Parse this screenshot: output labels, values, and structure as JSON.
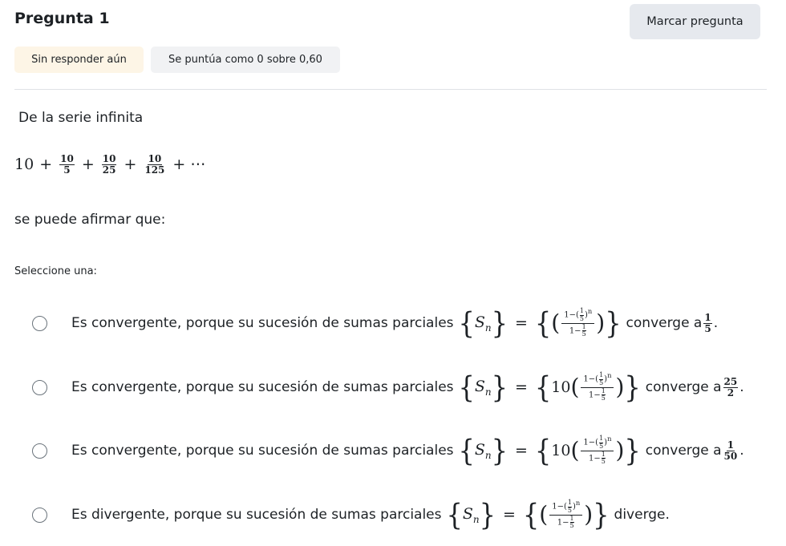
{
  "question": {
    "title": "Pregunta 1",
    "flag_label": "Marcar pregunta",
    "state": "Sin responder aún",
    "grade": "Se puntúa como 0 sobre 0,60"
  },
  "prompt": {
    "intro": "De la serie infinita",
    "series": {
      "first": "10",
      "terms": [
        {
          "num": "10",
          "den": "5"
        },
        {
          "num": "10",
          "den": "25"
        },
        {
          "num": "10",
          "den": "125"
        }
      ],
      "plus": "+",
      "ellipsis": "+ ⋯"
    },
    "outro": "se puede afirmar que:"
  },
  "select_label": "Seleccione una:",
  "formula_parts": {
    "sn_symbol": "S",
    "sn_sub": "n",
    "equals": "=",
    "numerator": "1−(",
    "numerator_exp": "n",
    "denominator": "1−",
    "one": "1",
    "five": "5"
  },
  "options": [
    {
      "prefix": "Es convergente, porque su sucesión de sumas parciales",
      "coef": "",
      "suffix": "converge a",
      "limit_num": "1",
      "limit_den": "5",
      "end": "."
    },
    {
      "prefix": "Es convergente, porque su sucesión de sumas parciales",
      "coef": "10",
      "suffix": "converge a",
      "limit_num": "25",
      "limit_den": "2",
      "end": "."
    },
    {
      "prefix": "Es convergente, porque su sucesión de sumas parciales",
      "coef": "10",
      "suffix": "converge a",
      "limit_num": "1",
      "limit_den": "50",
      "end": "."
    },
    {
      "prefix": "Es divergente, porque su sucesión de sumas parciales",
      "coef": "",
      "suffix": "diverge.",
      "limit_num": "",
      "limit_den": "",
      "end": ""
    }
  ]
}
